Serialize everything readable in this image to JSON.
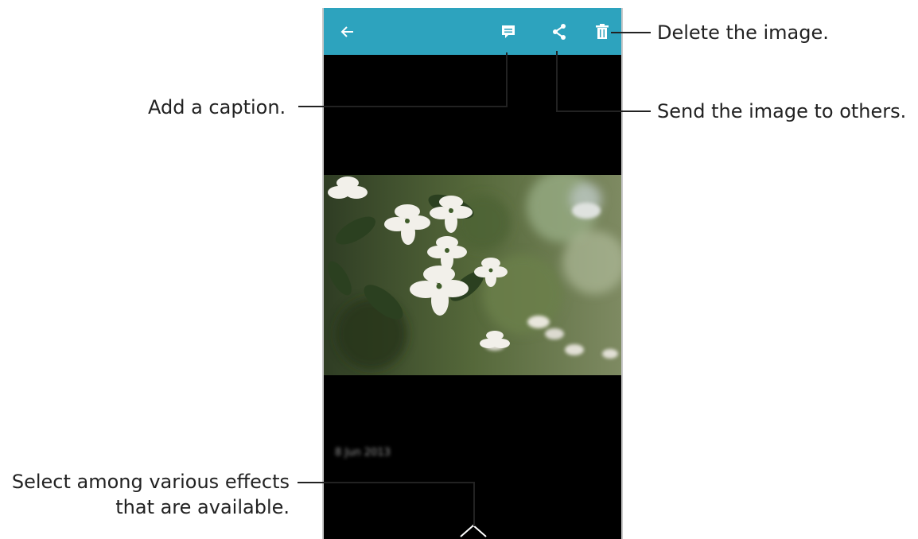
{
  "screen": {
    "toolbar": {
      "back_icon": "arrow-left-icon",
      "caption_icon": "caption-icon",
      "share_icon": "share-icon",
      "delete_icon": "trash-icon",
      "bar_color": "#2da3be"
    },
    "photo_date": "8 Jun 2013",
    "effects_icon": "chevron-up-icon"
  },
  "callouts": {
    "delete": "Delete the image.",
    "caption": "Add a caption.",
    "share": "Send the image to others.",
    "effects_line1": "Select among various effects",
    "effects_line2": "that are available."
  }
}
